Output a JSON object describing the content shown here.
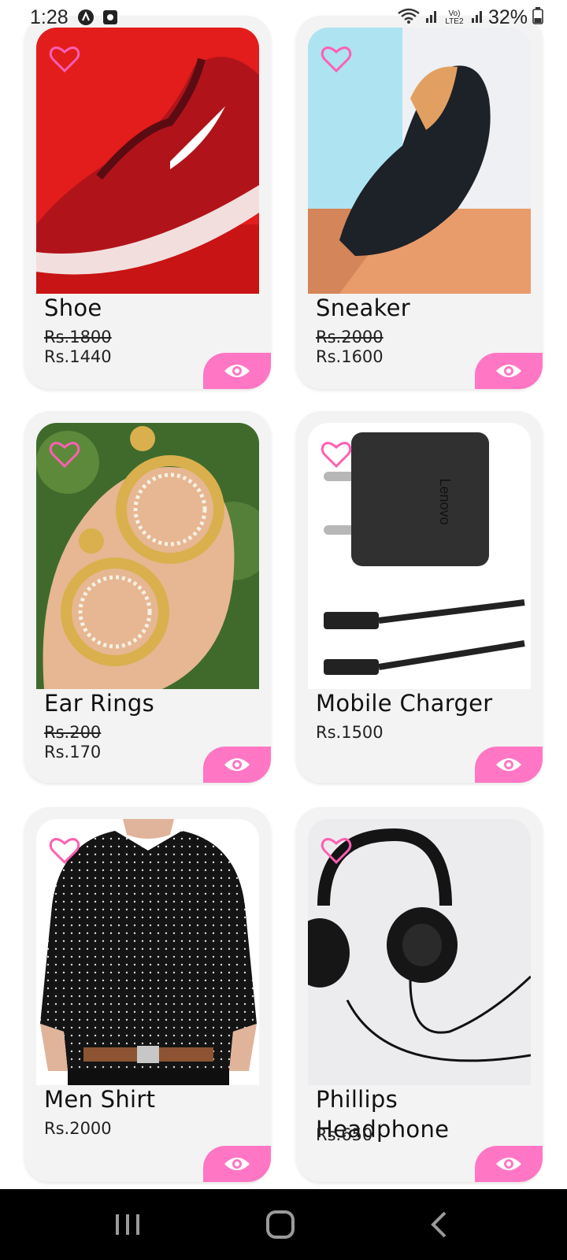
{
  "status_bar": {
    "time": "1:28",
    "battery_percent": "32%",
    "network_label": "Vo) LTE2"
  },
  "products": [
    {
      "name": "Shoe",
      "old_price": "Rs.1800",
      "price": "Rs.1440",
      "image": "red-sneaker-photo"
    },
    {
      "name": "Sneaker",
      "old_price": "Rs.2000",
      "price": "Rs.1600",
      "image": "black-loafer-photo"
    },
    {
      "name": "Ear Rings",
      "old_price": "Rs.200",
      "price": "Rs.170",
      "image": "gold-earrings-photo"
    },
    {
      "name": "Mobile Charger",
      "old_price": "",
      "price": "Rs.1500",
      "image": "charger-photo",
      "brand_text": "Lenovo"
    },
    {
      "name": "Men Shirt",
      "old_price": "",
      "price": "Rs.2000",
      "image": "polka-shirt-photo"
    },
    {
      "name": "Phillips Headphone",
      "old_price": "",
      "price": "Rs.650",
      "image": "headphones-photo"
    }
  ],
  "icons": {
    "favorite": "heart-outline-icon",
    "view": "eye-icon",
    "nav_recents": "recents-icon",
    "nav_home": "home-icon",
    "nav_back": "back-icon"
  },
  "colors": {
    "accent_pink": "#ff77c4",
    "card_bg": "#f3f3f3",
    "nav_bg": "#000000"
  }
}
